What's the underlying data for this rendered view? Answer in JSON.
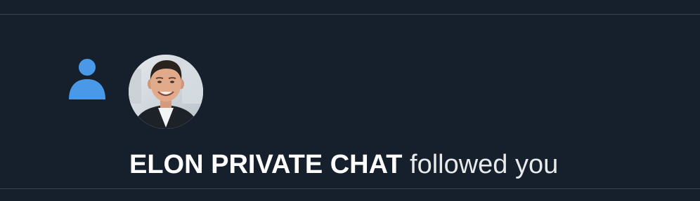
{
  "notification": {
    "type_icon": "person-icon",
    "icon_color": "#4a99e9",
    "user_name": "ELON PRIVATE CHAT",
    "action_text": "followed you"
  }
}
